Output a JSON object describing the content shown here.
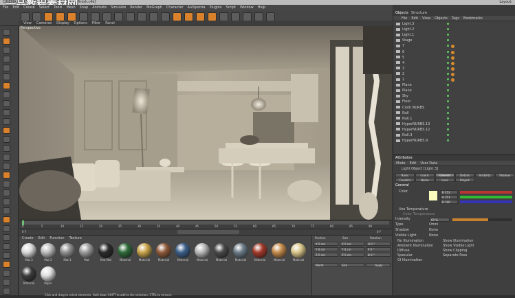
{
  "title_bar": {
    "text": "CINEMA 4D R13.061 Studio - [17_ceiling_is_finish.c4d]",
    "watermark": "一品教程素材网",
    "layout_label": "Layout:"
  },
  "menu": [
    "File",
    "Edit",
    "Create",
    "Select",
    "Tools",
    "Mesh",
    "Snap",
    "Animate",
    "Simulate",
    "Render",
    "MoGraph",
    "Character",
    "AixSponza",
    "Plugins",
    "Script",
    "Window",
    "Help"
  ],
  "viewport": {
    "menu": [
      "View",
      "Cameras",
      "Display",
      "Options",
      "Filter",
      "Panel"
    ],
    "label": "Perspective"
  },
  "timeline": {
    "ticks": [
      "0",
      "5",
      "10",
      "15",
      "20",
      "25",
      "30",
      "35",
      "40",
      "45",
      "50",
      "55",
      "60",
      "65",
      "70",
      "75",
      "80",
      "85",
      "90"
    ],
    "start": "0 F",
    "end": "0 F"
  },
  "materials": {
    "menu": [
      "Create",
      "Edit",
      "Function",
      "Texture"
    ],
    "items": [
      {
        "name": "Mat.3",
        "color": "#d9d9d9"
      },
      {
        "name": "Mat.2",
        "color": "#bdbdbd"
      },
      {
        "name": "Mat.1",
        "color": "#8e8e8e"
      },
      {
        "name": "Mat",
        "color": "#9a9a9a"
      },
      {
        "name": "Mat.Mat",
        "color": "#2a2a2a"
      },
      {
        "name": "Material",
        "color": "#2f6a3a"
      },
      {
        "name": "Material",
        "color": "#c9a44b"
      },
      {
        "name": "Material",
        "color": "#8f5a3a"
      },
      {
        "name": "Material",
        "color": "#3d5f8a"
      },
      {
        "name": "Material",
        "color": "#b8b8b8"
      },
      {
        "name": "Material",
        "color": "#4a4a4a"
      },
      {
        "name": "Material",
        "color": "#6a7b88"
      },
      {
        "name": "Material",
        "color": "#a33a2a"
      },
      {
        "name": "Material",
        "color": "#c48a4a"
      },
      {
        "name": "Material",
        "color": "#d9c68a"
      },
      {
        "name": "Material",
        "color": "#3c3c3c"
      },
      {
        "name": "Paper",
        "color": "#e0e0e0"
      }
    ]
  },
  "coordinates": {
    "headers": [
      "Position",
      "Size",
      "Rotation"
    ],
    "rows": [
      [
        "X 0 cm",
        "X 0 cm",
        "H 0 °"
      ],
      [
        "Y 0 cm",
        "Y 0 cm",
        "P 0 °"
      ],
      [
        "Z 0 cm",
        "Z 0 cm",
        "B 0 °"
      ]
    ],
    "mode1": "World",
    "mode2": "Size",
    "apply": "Apply"
  },
  "objects": {
    "tabs": [
      "Objects",
      "Structure"
    ],
    "menu": [
      "File",
      "Edit",
      "View",
      "Objects",
      "Tags",
      "Bookmarks"
    ],
    "rows": [
      "Light.3",
      "Light.2",
      "Light.1",
      "Stage",
      "7",
      "6",
      "5",
      "4",
      "3",
      "2",
      "1",
      "Plane",
      "Plane",
      "Sky",
      "Floor",
      "Cloth NURBS",
      "Null",
      "Null.1",
      "HyperNURBS.13",
      "HyperNURBS.12",
      "Null.3",
      "HyperNURBS.9"
    ]
  },
  "attributes": {
    "tab": "Attributes",
    "menu": [
      "Mode",
      "Edit",
      "User Data"
    ],
    "object_title": "Light Object [Light.3]",
    "tab_row1": [
      "Basic",
      "Coord.",
      "General",
      "Details",
      "Visibility",
      "Shadow"
    ],
    "tab_row2": [
      "Caustics",
      "Noise",
      "Lens",
      "Project"
    ],
    "active_tab": "General",
    "section": "General",
    "color_label": "Color",
    "rgb": [
      "R 251",
      "G 251",
      "B 190"
    ],
    "use_temperature": "Use Temperature",
    "color_temperature": "Color Temperature",
    "intensity_label": "Intensity",
    "intensity_value": "60 %",
    "type_label": "Type",
    "type_value": "Omni",
    "shadow_label": "Shadow",
    "shadow_value": "None",
    "visible_light_label": "Visible Light",
    "visible_light_value": "None",
    "checks_left": [
      "No Illumination",
      "Ambient Illumination",
      "Diffuse",
      "Specular",
      "GI Illumination"
    ],
    "checks_right": [
      "Show Illumination",
      "Show Visible Light",
      "Show Clipping",
      "Separate Pass"
    ]
  },
  "status": "Click and drag to select elements. Hold down SHIFT to add to the selection, CTRL to remove."
}
